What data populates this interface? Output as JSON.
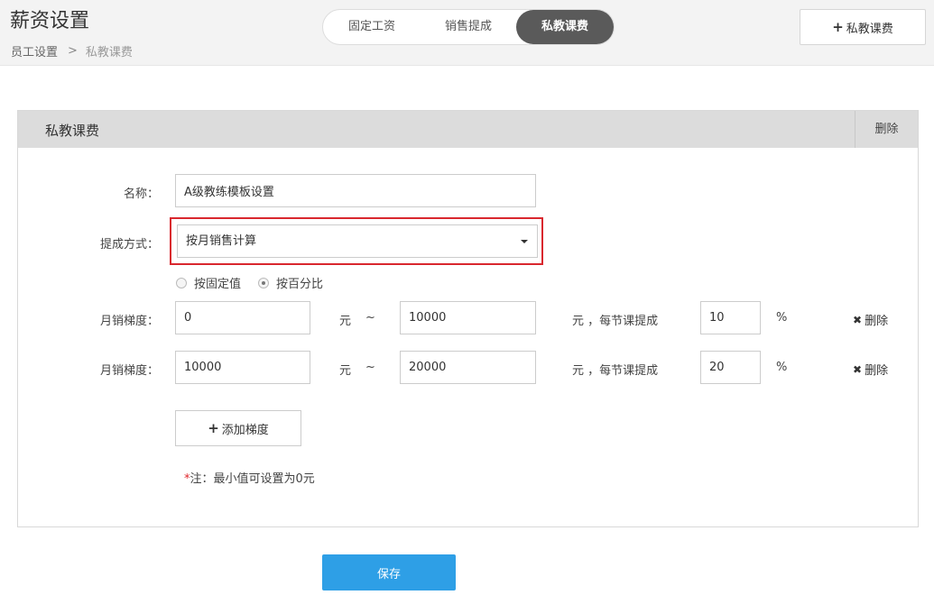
{
  "header": {
    "title": "薪资设置",
    "breadcrumb": {
      "parent": "员工设置",
      "separator": ">",
      "current": "私教课费"
    },
    "tabs": [
      "固定工资",
      "销售提成",
      "私教课费"
    ],
    "active_tab": "私教课费",
    "add_button": {
      "icon": "+",
      "label": "私教课费"
    }
  },
  "panel": {
    "title": "私教课费",
    "delete_label": "删除",
    "name_label": "名称：",
    "name_value": "A级教练模板设置",
    "method_label": "提成方式：",
    "method_value": "按月销售计算",
    "radios": [
      {
        "label": "按固定值",
        "checked": false
      },
      {
        "label": "按百分比",
        "checked": true
      }
    ],
    "tiers": [
      {
        "label": "月销梯度：",
        "from": "0",
        "unit_from": "元",
        "tilde": "~",
        "to": "10000",
        "unit_to": "元 ，每节课提成",
        "rate": "10",
        "percent": "%",
        "delete_icon": "✖",
        "delete": "删除"
      },
      {
        "label": "月销梯度：",
        "from": "10000",
        "unit_from": "元",
        "tilde": "~",
        "to": "20000",
        "unit_to": "元 ，每节课提成",
        "rate": "20",
        "percent": "%",
        "delete_icon": "✖",
        "delete": "删除"
      }
    ],
    "add_tier": {
      "icon": "+",
      "label": "添加梯度"
    },
    "note": {
      "star": "*",
      "text": "注：最小值可设置为0元"
    }
  },
  "save_label": "保存",
  "colors": {
    "active_tab": "#5a5a5a",
    "highlight_border": "#d9272e",
    "save_button": "#2e9fe6",
    "note_star": "#e0262b"
  }
}
